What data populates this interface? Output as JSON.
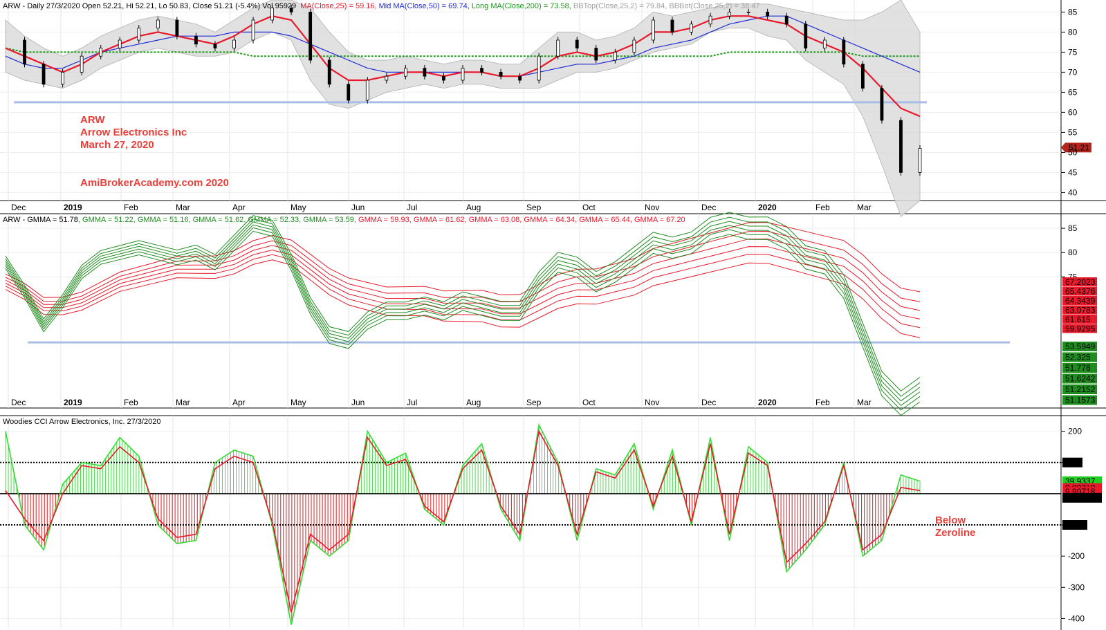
{
  "colors": {
    "ma25": "#e8192a",
    "ma50": "#1f2bd6",
    "ma200": "#1a9a1a",
    "bband": "#dcdcdc",
    "bbline": "#b0b0b0",
    "support": "#a9bde6",
    "gmma_short": "#1e8c1e",
    "gmma_long": "#e8192a",
    "cci_bar_up": "#4cd64c",
    "cci_bar_dn": "#d02020",
    "cci_line": "#33dd33",
    "cci_turbo": "#e8192a",
    "annotation": "#e8413b"
  },
  "pane1": {
    "title": "ARW - Daily 27/3/2020 Open 52.21, Hi 52.21, Lo 50.83, Close 51.21 (-5.4%) Vol 95929",
    "legend": [
      {
        "text": "MA(Close,25) = 59.16,",
        "color": "#e8192a"
      },
      {
        "text": "Mid MA(Close,50) = 69.74,",
        "color": "#1f2bd6"
      },
      {
        "text": "Long MA(Close,200) = 73.58,",
        "color": "#1a9a1a"
      },
      {
        "text": "BBTop(Close,25,2) = 79.84,",
        "color": "#a0a0a0"
      },
      {
        "text": "BBBot(Close,25,2) = 38.47",
        "color": "#a0a0a0"
      }
    ],
    "annotation": {
      "symbol": "ARW",
      "name": "Arrow Electronics Inc",
      "date": "March 27, 2020",
      "site": "AmiBrokerAcademy.com  2020"
    },
    "last_price_label": "51.21"
  },
  "pane2": {
    "title": "ARW - GMMA = 51.78, GMMA = 51.22, GMMA = 51.16, GMMA = 51.62, GMMA = 52.33, GMMA = 53.59, GMMA = 59.93, GMMA = 61.62, GMMA = 63.08, GMMA = 64.34, GMMA = 65.44, GMMA = 67.20",
    "short_labels": [
      "53.5949",
      "52.325",
      "51.778",
      "51.6242",
      "51.2152",
      "51.1573"
    ],
    "long_labels": [
      "67.2023",
      "65.4376",
      "64.3439",
      "63.0783",
      "61.615",
      "59.9295"
    ]
  },
  "pane3": {
    "title": "Woodies CCI  Arrow Electronics, Inc. 27/3/2020",
    "value_labels": [
      {
        "text": "100",
        "bg": "#000000",
        "fg": "#ffffff"
      },
      {
        "text": "39.9337",
        "bg": "#22cc22",
        "fg": "#000000"
      },
      {
        "text": "9.90718",
        "bg": "#e8192a",
        "fg": "#000000"
      },
      {
        "text": "9.90718",
        "bg": "#e8192a",
        "fg": "#000000"
      },
      {
        "text": "0.00000",
        "bg": "#000000",
        "fg": "#ffffff"
      },
      {
        "text": "-100",
        "bg": "#000000",
        "fg": "#ffffff"
      }
    ],
    "annotation_lines": [
      "Below",
      "Zeroline"
    ]
  },
  "months": [
    "Dec",
    "2019",
    "Feb",
    "Mar",
    "Apr",
    "May",
    "Jun",
    "Jul",
    "Aug",
    "Sep",
    "Oct",
    "Nov",
    "Dec",
    "2020",
    "Feb",
    "Mar"
  ],
  "chart_data": [
    {
      "type": "line",
      "title": "ARW - Daily 27/3/2020",
      "x": [
        "Dec",
        "2019",
        "Feb",
        "Mar",
        "Apr",
        "May",
        "Jun",
        "Jul",
        "Aug",
        "Sep",
        "Oct",
        "Nov",
        "Dec",
        "2020",
        "Feb",
        "Mar"
      ],
      "ylim": [
        38,
        88
      ],
      "yticks": [
        40,
        45,
        50,
        55,
        60,
        65,
        70,
        75,
        80,
        85
      ],
      "series": [
        {
          "name": "Close",
          "values": [
            78,
            72,
            67,
            70,
            74,
            76,
            78,
            81,
            83,
            79,
            77,
            76,
            78,
            83,
            86,
            85,
            73,
            67,
            63,
            68,
            69,
            71,
            69,
            68,
            71,
            70,
            69,
            68,
            74,
            78,
            76,
            73,
            75,
            78,
            83,
            80,
            82,
            84,
            85,
            85,
            84,
            82,
            76,
            78,
            72,
            66,
            58,
            45,
            51
          ]
        },
        {
          "name": "MA(Close,25)",
          "values": [
            76,
            74,
            72,
            70,
            72,
            75,
            77,
            79,
            80,
            79,
            78,
            77,
            79,
            82,
            84,
            83,
            77,
            71,
            68,
            68,
            69,
            70,
            70,
            69,
            70,
            70,
            69,
            69,
            71,
            74,
            75,
            74,
            75,
            77,
            80,
            80,
            81,
            83,
            84,
            84,
            83,
            82,
            79,
            77,
            75,
            71,
            66,
            61,
            59
          ]
        },
        {
          "name": "Mid MA(Close,50)",
          "values": [
            74,
            72,
            71,
            71,
            73,
            75,
            76,
            77,
            78,
            79,
            79,
            79,
            80,
            80,
            80,
            79,
            77,
            75,
            73,
            71,
            70,
            70,
            70,
            70,
            70,
            70,
            69,
            69,
            70,
            71,
            72,
            72,
            73,
            74,
            76,
            77,
            78,
            80,
            82,
            83,
            84,
            84,
            82,
            80,
            78,
            76,
            74,
            72,
            70
          ]
        },
        {
          "name": "Long MA(Close,200)",
          "values": [
            76,
            75,
            75,
            75,
            75,
            75,
            75,
            75,
            75,
            75,
            75,
            75,
            75,
            74,
            74,
            74,
            74,
            74,
            74,
            74,
            74,
            74,
            74,
            74,
            74,
            74,
            74,
            74,
            74,
            74,
            74,
            74,
            74,
            74,
            74,
            74,
            74,
            74,
            75,
            75,
            75,
            75,
            75,
            75,
            75,
            74,
            74,
            74,
            74
          ]
        },
        {
          "name": "BBTop(Close,25,2)",
          "values": [
            83,
            79,
            76,
            74,
            76,
            79,
            81,
            83,
            84,
            83,
            82,
            80,
            83,
            86,
            88,
            88,
            86,
            80,
            75,
            73,
            73,
            74,
            73,
            72,
            73,
            73,
            72,
            72,
            76,
            80,
            80,
            78,
            79,
            81,
            85,
            84,
            85,
            86,
            87,
            87,
            87,
            86,
            85,
            84,
            83,
            83,
            85,
            88,
            80
          ]
        },
        {
          "name": "BBBot(Close,25,2)",
          "values": [
            70,
            68,
            67,
            66,
            68,
            71,
            73,
            75,
            76,
            75,
            74,
            74,
            75,
            78,
            80,
            78,
            68,
            62,
            61,
            63,
            65,
            66,
            67,
            66,
            67,
            67,
            66,
            66,
            66,
            68,
            70,
            70,
            71,
            73,
            75,
            76,
            77,
            80,
            81,
            81,
            79,
            78,
            73,
            70,
            67,
            59,
            47,
            34,
            38
          ]
        }
      ]
    },
    {
      "type": "line",
      "title": "ARW - GMMA",
      "ylim": [
        48,
        88
      ],
      "yticks": [
        75,
        80,
        85
      ],
      "series": [
        {
          "name": "GMMA short (3)",
          "values": [
            78,
            72,
            65,
            70,
            76,
            79,
            80,
            81,
            80,
            79,
            80,
            78,
            82,
            86,
            85,
            78,
            69,
            63,
            62,
            66,
            68,
            68,
            69,
            68,
            70,
            69,
            68,
            68,
            74,
            78,
            77,
            74,
            76,
            79,
            82,
            81,
            82,
            85,
            86,
            85,
            85,
            83,
            79,
            78,
            73,
            63,
            53,
            49,
            51.8
          ]
        },
        {
          "name": "GMMA long (60)",
          "values": [
            74,
            72,
            69,
            69,
            70,
            72,
            74,
            75,
            76,
            77,
            77,
            77,
            78,
            80,
            81,
            80,
            77,
            74,
            72,
            71,
            70,
            70,
            70,
            69,
            69,
            69,
            68,
            68,
            70,
            72,
            73,
            73,
            74,
            75,
            77,
            78,
            79,
            80,
            81,
            82,
            82,
            81,
            80,
            79,
            78,
            75,
            71,
            68,
            67.2
          ]
        }
      ]
    },
    {
      "type": "bar",
      "title": "Woodies CCI  Arrow Electronics, Inc. 27/3/2020",
      "ylim": [
        -430,
        250
      ],
      "yticks": [
        -400,
        -300,
        -200,
        -100,
        100,
        200
      ],
      "series": [
        {
          "name": "CCI",
          "values": [
            200,
            -100,
            -180,
            30,
            100,
            90,
            180,
            120,
            -100,
            -160,
            -150,
            100,
            140,
            120,
            -100,
            -420,
            -150,
            -200,
            -150,
            200,
            100,
            130,
            -50,
            -100,
            90,
            160,
            -50,
            -150,
            220,
            100,
            -150,
            80,
            60,
            160,
            -50,
            140,
            -100,
            180,
            -150,
            150,
            100,
            -250,
            -180,
            -100,
            100,
            -200,
            -150,
            60,
            40
          ]
        },
        {
          "name": "Turbo CCI",
          "values": [
            10,
            -80,
            -150,
            0,
            90,
            80,
            150,
            100,
            -80,
            -140,
            -130,
            80,
            120,
            100,
            -90,
            -380,
            -130,
            -180,
            -130,
            180,
            90,
            110,
            -40,
            -90,
            80,
            140,
            -40,
            -130,
            200,
            90,
            -130,
            70,
            50,
            140,
            -40,
            120,
            -90,
            160,
            -130,
            130,
            90,
            -220,
            -160,
            -90,
            90,
            -180,
            -130,
            20,
            10
          ]
        }
      ]
    }
  ]
}
